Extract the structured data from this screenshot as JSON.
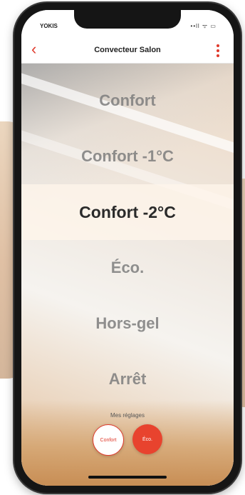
{
  "status_bar": {
    "carrier": "YOKIS",
    "icons": "••ll ᯤ ▭"
  },
  "header": {
    "title": "Convecteur Salon",
    "back_icon": "chevron-left-icon",
    "more_icon": "kebab-menu-icon"
  },
  "modes": [
    {
      "label": "Confort"
    },
    {
      "label": "Confort -1°C"
    },
    {
      "label": "Confort -2°C",
      "selected": true
    },
    {
      "label": "Éco."
    },
    {
      "label": "Hors-gel"
    },
    {
      "label": "Arrêt"
    }
  ],
  "presets": {
    "label": "Mes réglages",
    "items": [
      {
        "label": "Confort"
      },
      {
        "label": "Éco."
      }
    ]
  },
  "colors": {
    "accent": "#e0392b",
    "preset_eco": "#e8432e"
  }
}
